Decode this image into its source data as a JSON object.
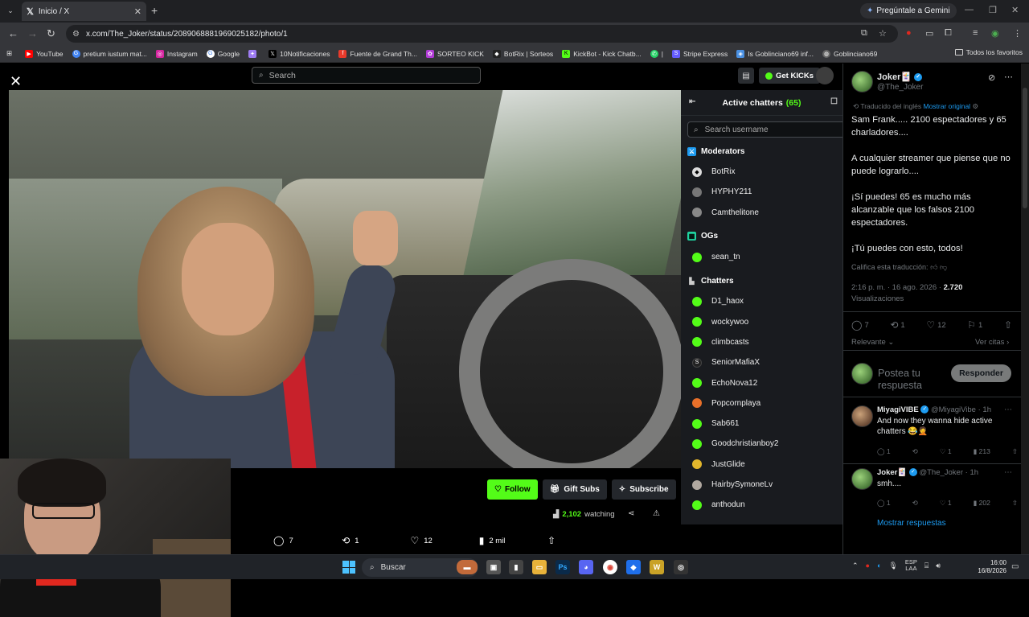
{
  "browser": {
    "tab_title": "Inicio / X",
    "gemini_label": "Pregúntale a Gemini",
    "url": "x.com/The_Joker/status/2089068881969025182/photo/1"
  },
  "bookmarks": [
    {
      "label": "YouTube",
      "color": "#ff0000"
    },
    {
      "label": "pretium iustum mat...",
      "color": "#4285f4"
    },
    {
      "label": "Instagram",
      "color": "#d6249f"
    },
    {
      "label": "Google",
      "color": "#4285f4"
    },
    {
      "label": "",
      "color": "#9e7cf2"
    },
    {
      "label": "10Notificaciones",
      "color": "#000000"
    },
    {
      "label": "Fuente de Grand Th...",
      "color": "#e83a2b"
    },
    {
      "label": "SORTEO KICK",
      "color": "#b13bd6"
    },
    {
      "label": "BotRix | Sorteos",
      "color": "#222222"
    },
    {
      "label": "KickBot - Kick Chatb...",
      "color": "#53fc18"
    },
    {
      "label": "|",
      "color": "#25d366"
    },
    {
      "label": "Stripe Express",
      "color": "#635bff"
    },
    {
      "label": "Is Goblinciano69 inf...",
      "color": "#4a90e2"
    },
    {
      "label": "Goblinciano69",
      "color": "#666666"
    }
  ],
  "all_favorites": "Todos los favoritos",
  "kick": {
    "search_placeholder": "Search",
    "get_kicks": "Get KICKs",
    "chatters_title": "Active chatters",
    "chatters_count": "(65)",
    "username_placeholder": "Search username",
    "sections": [
      {
        "title": "Moderators",
        "icon_color": "#1d9bf0",
        "members": [
          {
            "name": "BotRix",
            "badge_color": "#dddddd"
          },
          {
            "name": "HYPHY211",
            "badge_color": "#777777"
          },
          {
            "name": "Camthelitone",
            "badge_color": "#888888"
          }
        ]
      },
      {
        "title": "OGs",
        "icon_color": "#1fd3a0",
        "members": [
          {
            "name": "sean_tn",
            "badge_color": "#53fc18"
          }
        ]
      },
      {
        "title": "Chatters",
        "icon_color": "#cccccc",
        "members": [
          {
            "name": "D1_haox",
            "badge_color": "#53fc18"
          },
          {
            "name": "wockywoo",
            "badge_color": "#53fc18"
          },
          {
            "name": "climbcasts",
            "badge_color": "#53fc18"
          },
          {
            "name": "SeniorMafiaX",
            "badge_color": "#222222"
          },
          {
            "name": "EchoNova12",
            "badge_color": "#53fc18"
          },
          {
            "name": "Popcornplaya",
            "badge_color": "#e8702a"
          },
          {
            "name": "Sab661",
            "badge_color": "#53fc18"
          },
          {
            "name": "Goodchristianboy2",
            "badge_color": "#53fc18"
          },
          {
            "name": "JustGlide",
            "badge_color": "#e2b62c"
          },
          {
            "name": "HairbySymoneLv",
            "badge_color": "#b0a8a0"
          },
          {
            "name": "anthodun",
            "badge_color": "#53fc18"
          }
        ]
      }
    ],
    "follow": "Follow",
    "gift_subs": "Gift Subs",
    "subscribe": "Subscribe",
    "watching_count": "2,102",
    "watching_label": "watching"
  },
  "photo_actions": {
    "replies": "7",
    "reposts": "1",
    "likes": "12",
    "views": "2 mil"
  },
  "tweet": {
    "author_name": "Joker🃏",
    "author_handle": "@The_Joker",
    "translated_label": "Traducido del inglés",
    "show_original": "Mostrar original",
    "paragraphs": [
      "Sam Frank..... 2100 espectadores y 65 charladores....",
      "A cualquier streamer que piense que no puede lograrlo....",
      "¡Sí puedes! 65 es mucho más alcanzable que los falsos 2100 espectadores.",
      "¡Tú puedes con esto, todos!"
    ],
    "rate_translation": "Califica esta traducción:",
    "time": "2:16 p. m. · 16 ago. 2026 ·",
    "views_count": "2.720",
    "views_label": "Visualizaciones",
    "stats": {
      "replies": "7",
      "reposts": "1",
      "likes": "12",
      "bookmarks": "1"
    },
    "sort_label": "Relevante",
    "quotes_label": "Ver citas",
    "reply_placeholder": "Postea tu respuesta",
    "reply_button": "Responder"
  },
  "replies": [
    {
      "name": "MiyagiVIBE",
      "handle": "@MiyagiVibe · 1h",
      "text": "And now they wanna hide active chatters 😂🤦",
      "replies": "1",
      "reposts": "",
      "likes": "1",
      "views": "213"
    },
    {
      "name": "Joker🃏",
      "handle": "@The_Joker · 1h",
      "text": "smh....",
      "replies": "1",
      "reposts": "",
      "likes": "1",
      "views": "202"
    }
  ],
  "show_replies": "Mostrar respuestas",
  "taskbar": {
    "search": "Buscar",
    "lang_top": "ESP",
    "lang_bottom": "LAA",
    "time": "16:00",
    "date": "16/8/2026"
  },
  "colors": {
    "kick_green": "#53fc18",
    "x_blue": "#1d9bf0"
  }
}
